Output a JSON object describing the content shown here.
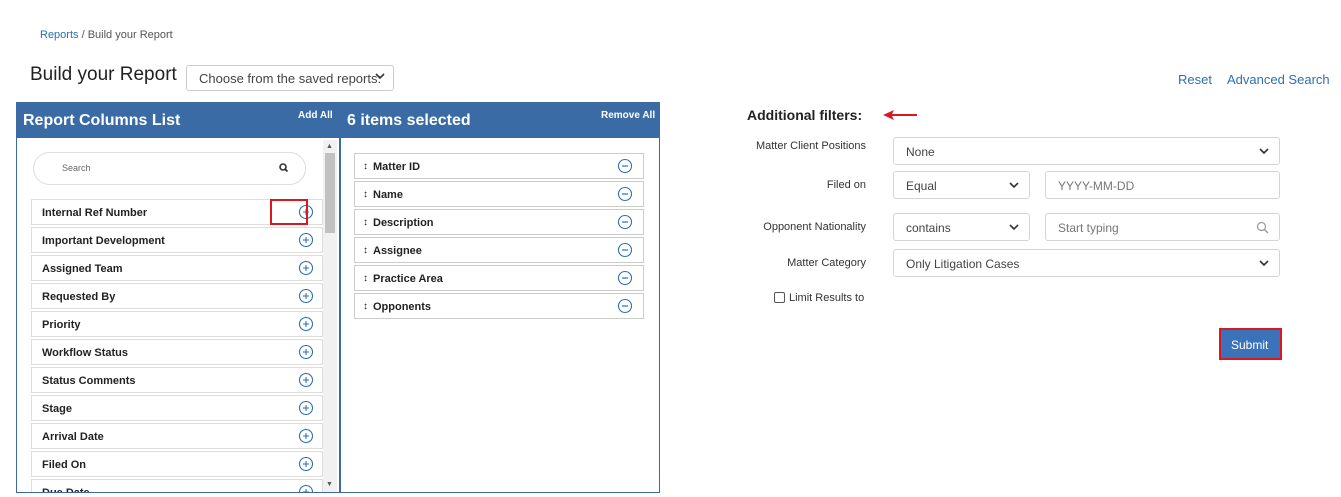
{
  "breadcrumb": {
    "root": "Reports",
    "separator": "/",
    "current": "Build your Report"
  },
  "page_title": "Build your Report",
  "saved_reports": {
    "selected": "Choose from the saved reports:"
  },
  "top_links": {
    "reset": "Reset",
    "advanced_search": "Advanced Search"
  },
  "columns_panel": {
    "title": "Report Columns List",
    "add_all": "Add All",
    "search_placeholder": "Search",
    "items": [
      "Internal Ref Number",
      "Important Development",
      "Assigned Team",
      "Requested By",
      "Priority",
      "Workflow Status",
      "Status Comments",
      "Stage",
      "Arrival Date",
      "Filed On",
      "Due Date"
    ]
  },
  "selected_panel": {
    "title": "6 items selected",
    "remove_all": "Remove All",
    "grip": "↕",
    "items": [
      "Matter ID",
      "Name",
      "Description",
      "Assignee",
      "Practice Area",
      "Opponents"
    ]
  },
  "filters": {
    "title": "Additional filters:",
    "matter_client_positions": {
      "label": "Matter Client Positions",
      "value": "None"
    },
    "filed_on": {
      "label": "Filed on",
      "operator": "Equal",
      "date_placeholder": "YYYY-MM-DD"
    },
    "opponent_nationality": {
      "label": "Opponent Nationality",
      "operator": "contains",
      "placeholder": "Start typing"
    },
    "matter_category": {
      "label": "Matter Category",
      "value": "Only Litigation Cases"
    },
    "limit_results": {
      "label": "Limit Results to",
      "checked": false
    }
  },
  "submit_label": "Submit",
  "colors": {
    "header_blue": "#3b6ba5",
    "link_blue": "#2f6fb4",
    "highlight_red": "#d9191f",
    "button_blue": "#3b73ba"
  }
}
